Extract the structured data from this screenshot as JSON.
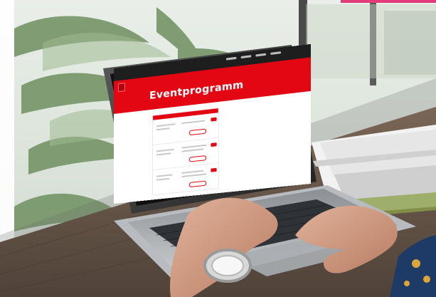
{
  "screen": {
    "title": "Eventprogramm"
  },
  "colors": {
    "brand_red": "#e30613",
    "accent_pink": "#e23b7a",
    "laptop_body": "#2b2b2b",
    "wood_table": "#6b5a4c"
  },
  "icons": {
    "logo": "brand-logo-icon"
  }
}
